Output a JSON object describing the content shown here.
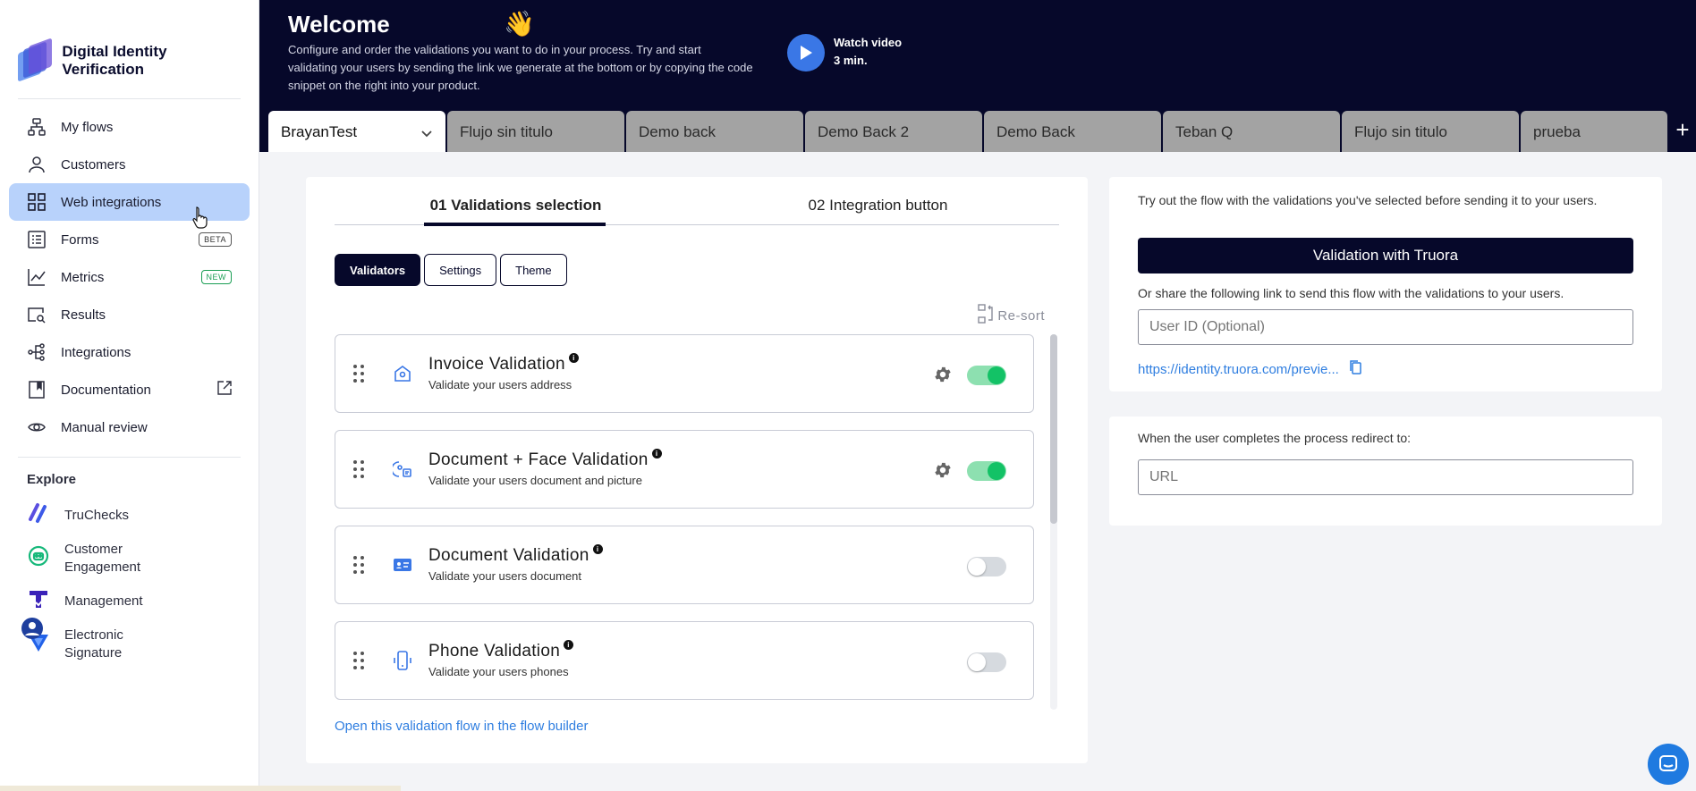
{
  "brand": {
    "name": "Digital Identity Verification"
  },
  "nav": {
    "items": [
      {
        "label": "My flows",
        "icon": "flows-icon"
      },
      {
        "label": "Customers",
        "icon": "user-icon"
      },
      {
        "label": "Web integrations",
        "icon": "grid-icon",
        "active": true
      },
      {
        "label": "Forms",
        "icon": "form-icon",
        "badge": "BETA"
      },
      {
        "label": "Metrics",
        "icon": "chart-icon",
        "badge": "NEW"
      },
      {
        "label": "Results",
        "icon": "search-doc-icon"
      },
      {
        "label": "Integrations",
        "icon": "integrations-icon"
      },
      {
        "label": "Documentation",
        "icon": "book-icon"
      },
      {
        "label": "Manual review",
        "icon": "eye-icon"
      }
    ]
  },
  "explore": {
    "title": "Explore",
    "items": [
      {
        "label": "TruChecks"
      },
      {
        "label": "Customer Engagement"
      },
      {
        "label": "Management"
      },
      {
        "label": "Electronic Signature"
      }
    ]
  },
  "header": {
    "title": "Welcome",
    "emoji": "👋",
    "description": "Configure and order the validations you want to do in your process. Try and start validating your users by sending the link we generate at the bottom or by copying the code snippet on the right into your product.",
    "video_label": "Watch video",
    "video_duration": "3 min."
  },
  "tabs": [
    {
      "label": "BrayanTest",
      "active": true
    },
    {
      "label": "Flujo sin titulo"
    },
    {
      "label": "Demo back"
    },
    {
      "label": "Demo Back 2"
    },
    {
      "label": "Demo Back"
    },
    {
      "label": "Teban Q"
    },
    {
      "label": "Flujo sin titulo"
    },
    {
      "label": "prueba"
    }
  ],
  "steps": [
    {
      "label": "01 Validations selection",
      "active": true
    },
    {
      "label": "02 Integration button"
    }
  ],
  "pills": [
    {
      "label": "Validators",
      "active": true
    },
    {
      "label": "Settings"
    },
    {
      "label": "Theme"
    }
  ],
  "resort_label": "Re-sort",
  "validations": [
    {
      "title": "Invoice Validation",
      "subtitle": "Validate your users address",
      "enabled": true,
      "icon": "house-doc-icon"
    },
    {
      "title": "Document + Face Validation",
      "subtitle": "Validate your users document and picture",
      "enabled": true,
      "icon": "face-id-icon"
    },
    {
      "title": "Document Validation",
      "subtitle": "Validate your users document",
      "enabled": false,
      "icon": "id-card-icon"
    },
    {
      "title": "Phone Validation",
      "subtitle": "Validate your users phones",
      "enabled": false,
      "icon": "phone-icon"
    }
  ],
  "open_flow_builder_link": "Open this validation flow in the flow builder",
  "try_card": {
    "description": "Try out the flow with the validations you've selected before sending it to your users.",
    "button_label": "Validation with Truora",
    "share_text": "Or share the following link to send this flow with the validations to your users.",
    "user_id_placeholder": "User ID (Optional)",
    "link": "https://identity.truora.com/previe..."
  },
  "redirect_card": {
    "label": "When the user completes the process redirect to:",
    "url_placeholder": "URL"
  },
  "colors": {
    "header_bg": "#06082a",
    "active_nav": "#b8d2fb",
    "accent_blue": "#2f7ee0",
    "toggle_on": "#13c266"
  }
}
